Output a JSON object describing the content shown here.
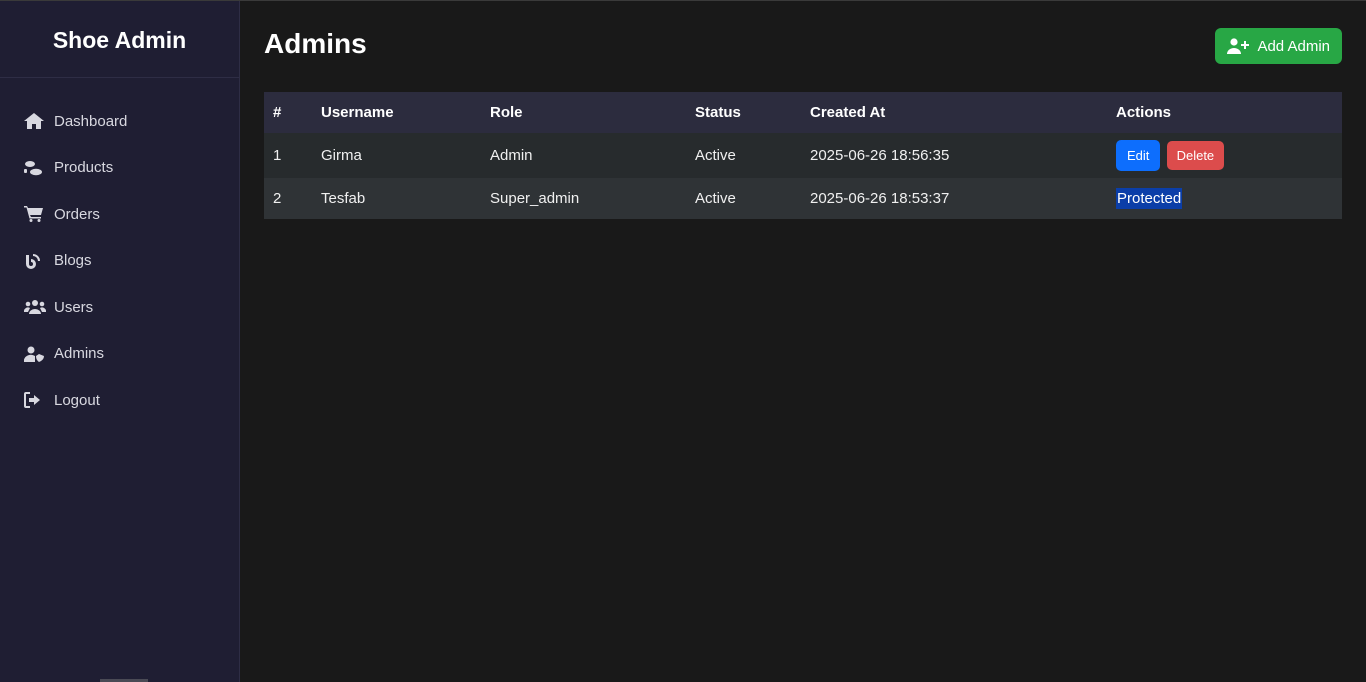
{
  "brand": "Shoe Admin",
  "sidebar": {
    "items": [
      {
        "label": "Dashboard",
        "icon": "home-icon"
      },
      {
        "label": "Products",
        "icon": "shoe-prints-icon"
      },
      {
        "label": "Orders",
        "icon": "cart-icon"
      },
      {
        "label": "Blogs",
        "icon": "blog-icon"
      },
      {
        "label": "Users",
        "icon": "users-icon"
      },
      {
        "label": "Admins",
        "icon": "user-shield-icon"
      },
      {
        "label": "Logout",
        "icon": "logout-icon"
      }
    ]
  },
  "page": {
    "title": "Admins",
    "add_button": "Add Admin"
  },
  "table": {
    "headers": [
      "#",
      "Username",
      "Role",
      "Status",
      "Created At",
      "Actions"
    ],
    "rows": [
      {
        "num": "1",
        "username": "Girma",
        "role": "Admin",
        "status": "Active",
        "created": "2025-06-26 18:56:35",
        "edit": "Edit",
        "delete": "Delete"
      },
      {
        "num": "2",
        "username": "Tesfab",
        "role": "Super_admin",
        "status": "Active",
        "created": "2025-06-26 18:53:37",
        "protected": "Protected"
      }
    ]
  },
  "colors": {
    "sidebar_bg": "#1f1e33",
    "main_bg": "#191919",
    "add_button": "#28a745",
    "edit_button": "#0d6efd",
    "delete_button": "#dc4c4c",
    "protected_badge": "#0b3ea8"
  }
}
